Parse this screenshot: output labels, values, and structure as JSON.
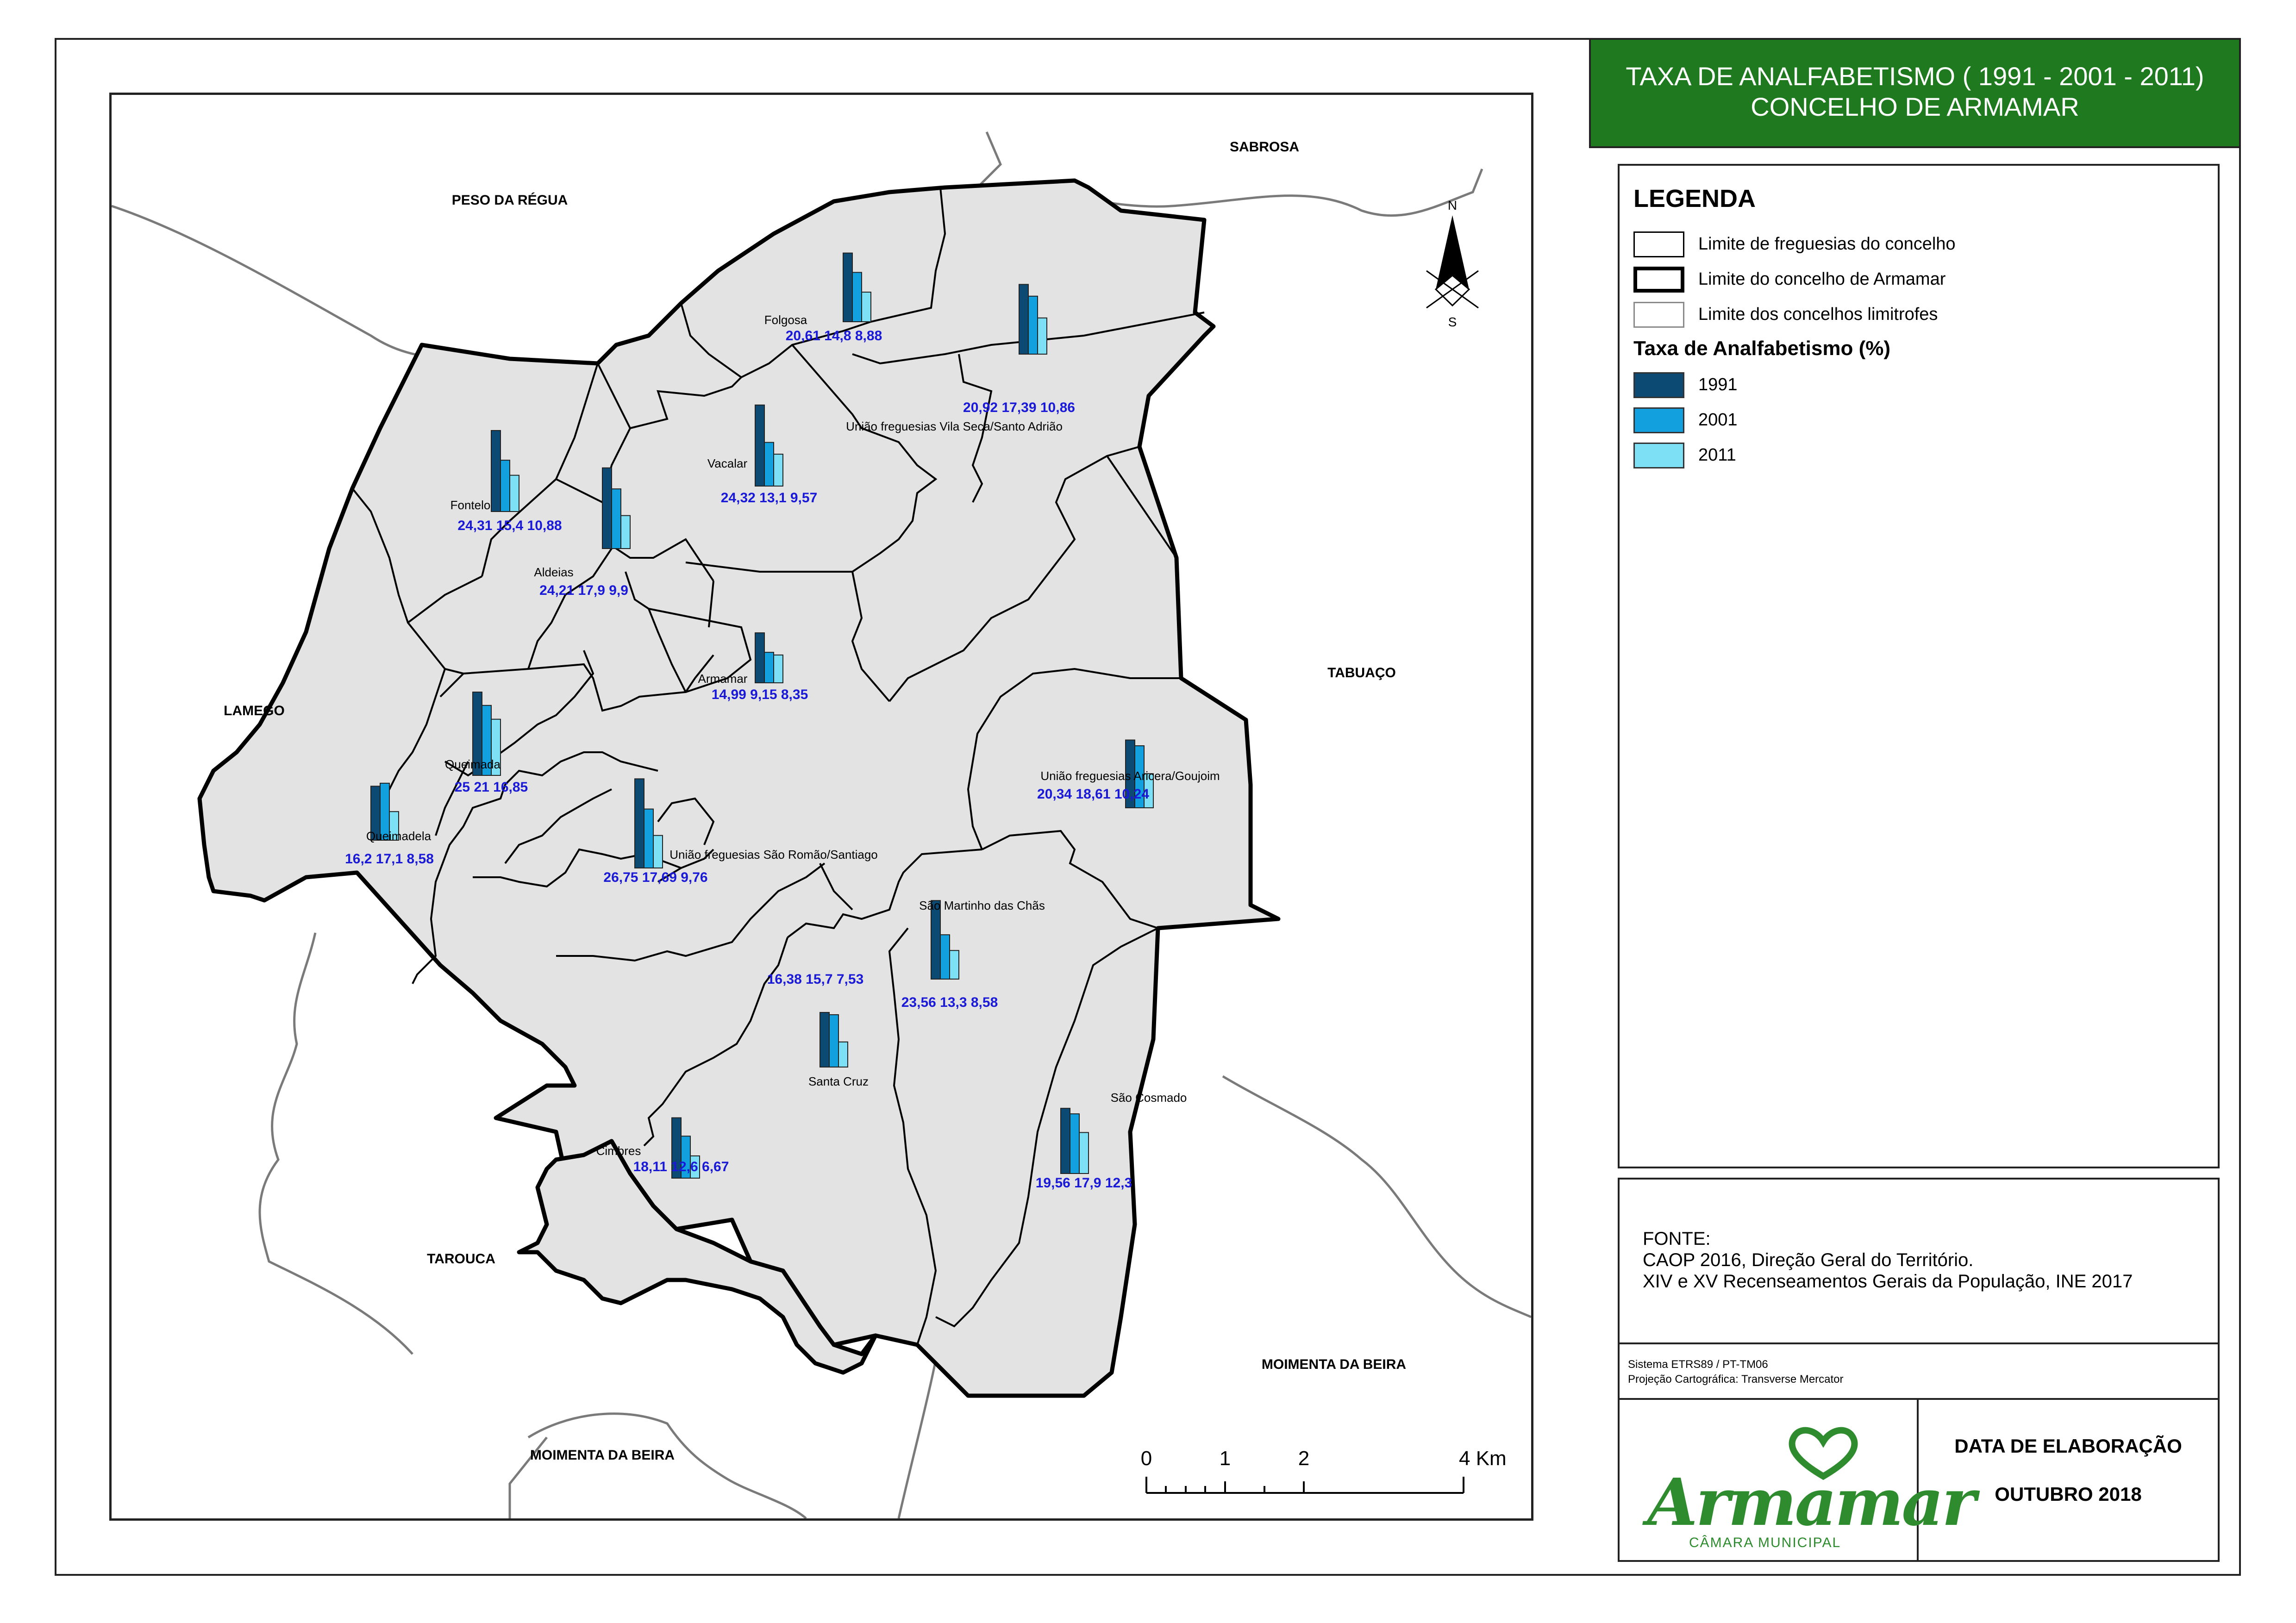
{
  "title": {
    "line1": "TAXA DE ANALFABETISMO ( 1991 - 2001 - 2011)",
    "line2": "CONCELHO DE ARMAMAR"
  },
  "colors": {
    "title_bg": "#1f7a1f",
    "concelho_fill": "#e3e3e3",
    "y1991": "#0d4a73",
    "y2001": "#12a0df",
    "y2011": "#7de0f5",
    "value_text": "#1a1ad6",
    "logo_green": "#2e8b2e"
  },
  "legend": {
    "title": "LEGENDA",
    "items": [
      {
        "label": "Limite de freguesias do concelho"
      },
      {
        "label": "Limite do concelho de Armamar"
      },
      {
        "label": "Limite dos concelhos limitrofes"
      }
    ],
    "rate_title": "Taxa de Analfabetismo (%)",
    "years": [
      "1991",
      "2001",
      "2011"
    ]
  },
  "source": {
    "heading": "FONTE:",
    "line1": "CAOP 2016, Direção Geral do Território.",
    "line2": "XIV e XV Recenseamentos Gerais da População, INE 2017"
  },
  "crs": {
    "line1": "Sistema ETRS89 / PT-TM06",
    "line2": "Projeção Cartográfica: Transverse Mercator"
  },
  "date": {
    "label": "DATA DE ELABORAÇÃO",
    "value": "OUTUBRO 2018"
  },
  "logo": {
    "name": "Armamar",
    "subtitle": "CÂMARA MUNICIPAL"
  },
  "north_arrow": {
    "n": "N",
    "s": "S"
  },
  "scale_bar": {
    "labels": [
      "0",
      "1",
      "2",
      "4 Km"
    ]
  },
  "neighbours": [
    "PESO DA RÉGUA",
    "SABROSA",
    "LAMEGO",
    "TABUAÇO",
    "TAROUCA",
    "MOIMENTA DA BEIRA",
    "MOIMENTA DA BEIRA"
  ],
  "chart_data": {
    "type": "bar",
    "title": "TAXA DE ANALFABETISMO ( 1991 - 2001 - 2011)",
    "unit": "%",
    "series_names": [
      "1991",
      "2001",
      "2011"
    ],
    "freguesias": [
      {
        "name": "Folgosa",
        "values": [
          20.61,
          14.8,
          8.88
        ],
        "labels": [
          "20,61",
          "14,8",
          "8,88"
        ]
      },
      {
        "name": "União freguesias Vila Seca/Santo Adrião",
        "values": [
          20.92,
          17.39,
          10.86
        ],
        "labels": [
          "20,92",
          "17,39",
          "10,86"
        ]
      },
      {
        "name": "Vacalar",
        "values": [
          24.32,
          13.1,
          9.57
        ],
        "labels": [
          "24,32",
          "13,1",
          "9,57"
        ]
      },
      {
        "name": "Fontelo",
        "values": [
          24.31,
          15.4,
          10.88
        ],
        "labels": [
          "24,31",
          "15,4",
          "10,88"
        ]
      },
      {
        "name": "Aldeias",
        "values": [
          24.21,
          17.9,
          9.9
        ],
        "labels": [
          "24,21",
          "17,9",
          "9,9"
        ]
      },
      {
        "name": "Armamar",
        "values": [
          14.99,
          9.15,
          8.35
        ],
        "labels": [
          "14,99",
          "9,15",
          "8,35"
        ]
      },
      {
        "name": "Queimada",
        "values": [
          25,
          21,
          16.85
        ],
        "labels": [
          "25",
          "21",
          "16,85"
        ]
      },
      {
        "name": "Queimadela",
        "values": [
          16.2,
          17.1,
          8.58
        ],
        "labels": [
          "16,2",
          "17,1",
          "8,58"
        ]
      },
      {
        "name": "União freguesias São Romão/Santiago",
        "values": [
          26.75,
          17.69,
          9.76
        ],
        "labels": [
          "26,75",
          "17,69",
          "9,76"
        ]
      },
      {
        "name": "União freguesias Aricera/Goujoim",
        "values": [
          20.34,
          18.61,
          10.24
        ],
        "labels": [
          "20,34",
          "18,61",
          "10,24"
        ]
      },
      {
        "name": "São Martinho das Chãs",
        "values": [
          23.56,
          13.3,
          8.58
        ],
        "labels": [
          "23,56",
          "13,3",
          "8,58"
        ]
      },
      {
        "name": "Santa Cruz",
        "values": [
          16.38,
          15.7,
          7.53
        ],
        "labels": [
          "16,38",
          "15,7",
          "7,53"
        ]
      },
      {
        "name": "Cimbres",
        "values": [
          18.11,
          12.6,
          6.67
        ],
        "labels": [
          "18,11",
          "12,6",
          "6,67"
        ]
      },
      {
        "name": "São Cosmado",
        "values": [
          19.56,
          17.9,
          12.3
        ],
        "labels": [
          "19,56",
          "17,9",
          "12,3"
        ]
      }
    ]
  }
}
